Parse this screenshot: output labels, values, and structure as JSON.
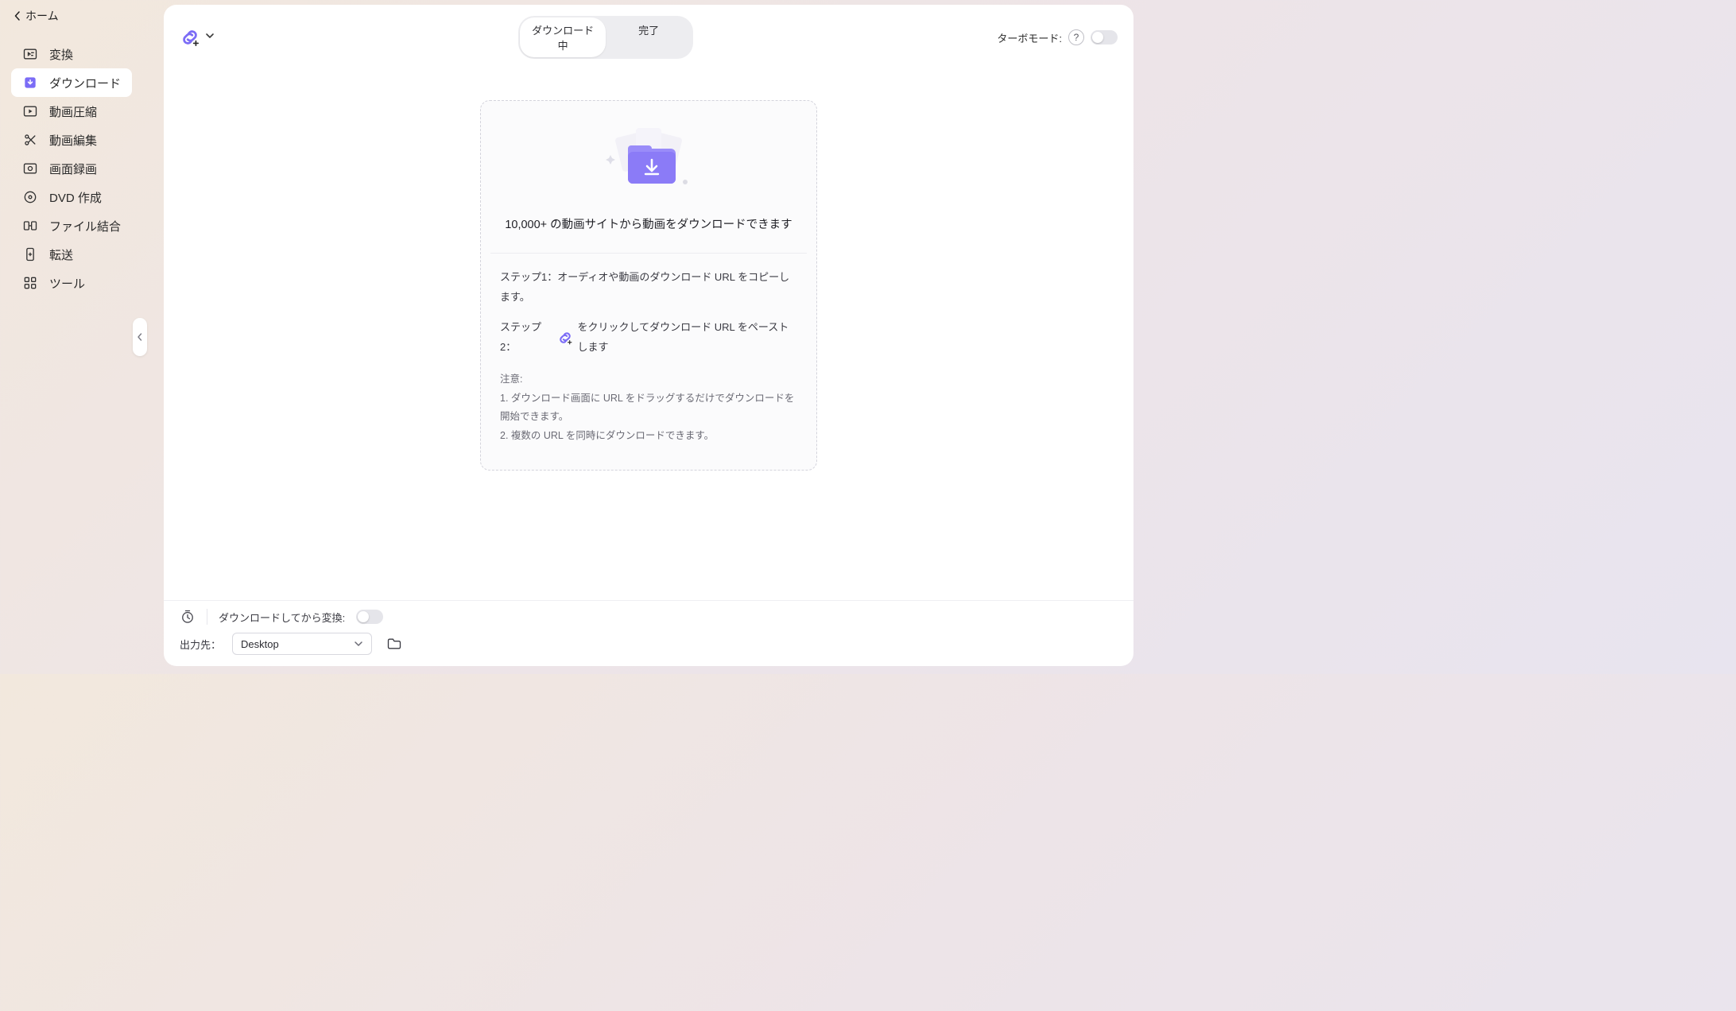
{
  "home_label": "ホーム",
  "sidebar": {
    "items": [
      {
        "label": "変換"
      },
      {
        "label": "ダウンロード"
      },
      {
        "label": "動画圧縮"
      },
      {
        "label": "動画編集"
      },
      {
        "label": "画面録画"
      },
      {
        "label": "DVD 作成"
      },
      {
        "label": "ファイル結合"
      },
      {
        "label": "転送"
      },
      {
        "label": "ツール"
      }
    ],
    "active_index": 1
  },
  "tabs": {
    "downloading": "ダウンロード中",
    "done": "完了"
  },
  "turbo": {
    "label": "ターボモード:"
  },
  "dropzone": {
    "headline": "10,000+ の動画サイトから動画をダウンロードできます",
    "step1": "ステップ1：オーディオや動画のダウンロード URL をコピーします。",
    "step2_prefix": "ステップ2：",
    "step2_suffix": "をクリックしてダウンロード URL をペーストします",
    "note_title": "注意:",
    "note1": "1. ダウンロード画面に URL をドラッグするだけでダウンロードを開始できます。",
    "note2": "2. 複数の URL を同時にダウンロードできます。"
  },
  "footer": {
    "convert_after_label": "ダウンロードしてから変換:",
    "output_label": "出力先：",
    "output_value": "Desktop"
  },
  "colors": {
    "accent": "#7b6cf6"
  }
}
